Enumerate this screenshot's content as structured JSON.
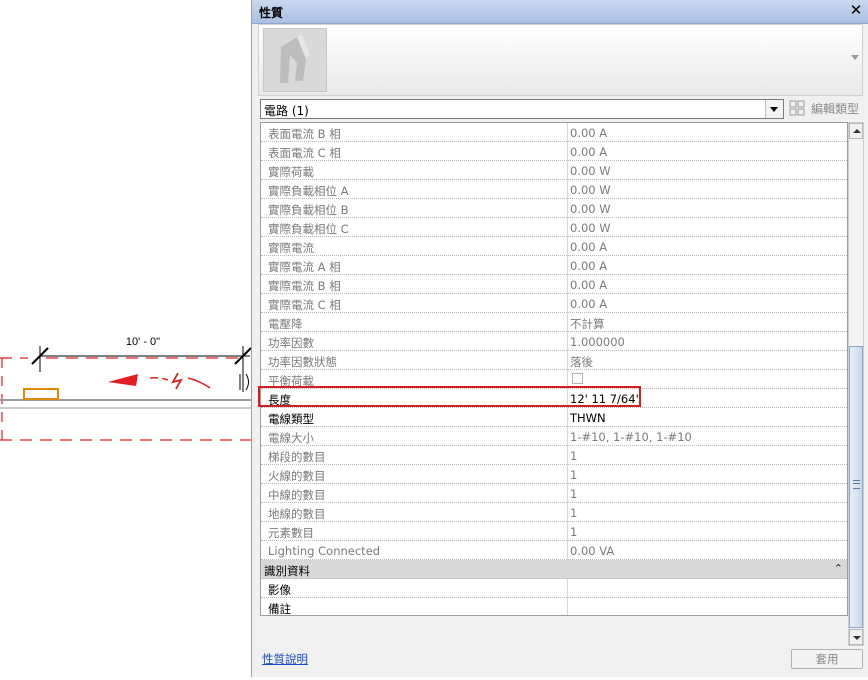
{
  "drawing": {
    "dimension_label": "10' - 0\""
  },
  "panel": {
    "title": "性質",
    "close_glyph": "✕",
    "type_selector_value": "電路 (1)",
    "edit_type_label": "編輯類型",
    "help_link": "性質說明",
    "apply_button": "套用"
  },
  "properties": [
    {
      "name": "表面電流 B 相",
      "value": "0.00 A",
      "editable": false
    },
    {
      "name": "表面電流 C 相",
      "value": "0.00 A",
      "editable": false
    },
    {
      "name": "實際荷載",
      "value": "0.00 W",
      "editable": false
    },
    {
      "name": "實際負載相位 A",
      "value": "0.00 W",
      "editable": false
    },
    {
      "name": "實際負載相位 B",
      "value": "0.00 W",
      "editable": false
    },
    {
      "name": "實際負載相位 C",
      "value": "0.00 W",
      "editable": false
    },
    {
      "name": "實際電流",
      "value": "0.00 A",
      "editable": false
    },
    {
      "name": "實際電流 A 相",
      "value": "0.00 A",
      "editable": false
    },
    {
      "name": "實際電流 B 相",
      "value": "0.00 A",
      "editable": false
    },
    {
      "name": "實際電流 C 相",
      "value": "0.00 A",
      "editable": false
    },
    {
      "name": "電壓降",
      "value": "不計算",
      "editable": false
    },
    {
      "name": "功率因數",
      "value": "1.000000",
      "editable": false
    },
    {
      "name": "功率因數狀態",
      "value": "落後",
      "editable": false
    },
    {
      "name": "平衡荷載",
      "value": "",
      "checkbox": true,
      "editable": false
    },
    {
      "name": "長度",
      "value": "12'  11 7/64\"",
      "editable": true
    },
    {
      "name": "電線類型",
      "value": "THWN",
      "editable": true
    },
    {
      "name": "電線大小",
      "value": "1-#10, 1-#10, 1-#10",
      "editable": false
    },
    {
      "name": "梯段的數目",
      "value": "1",
      "editable": false
    },
    {
      "name": "火線的數目",
      "value": "1",
      "editable": false
    },
    {
      "name": "中線的數目",
      "value": "1",
      "editable": false
    },
    {
      "name": "地線的數目",
      "value": "1",
      "editable": false
    },
    {
      "name": "元素數目",
      "value": "1",
      "editable": false
    },
    {
      "name": "Lighting Connected",
      "value": "0.00 VA",
      "editable": false
    }
  ],
  "identity_section": {
    "title": "識別資料",
    "collapse_glyph": "⌃",
    "rows": [
      {
        "name": "影像",
        "value": "",
        "editable": true
      },
      {
        "name": "備註",
        "value": "",
        "editable": true
      }
    ]
  },
  "colors": {
    "highlight": "#d21f1f",
    "drawing_red": "#e02020",
    "fixture_orange": "#e08a00",
    "link_blue": "#1a4fc6"
  }
}
